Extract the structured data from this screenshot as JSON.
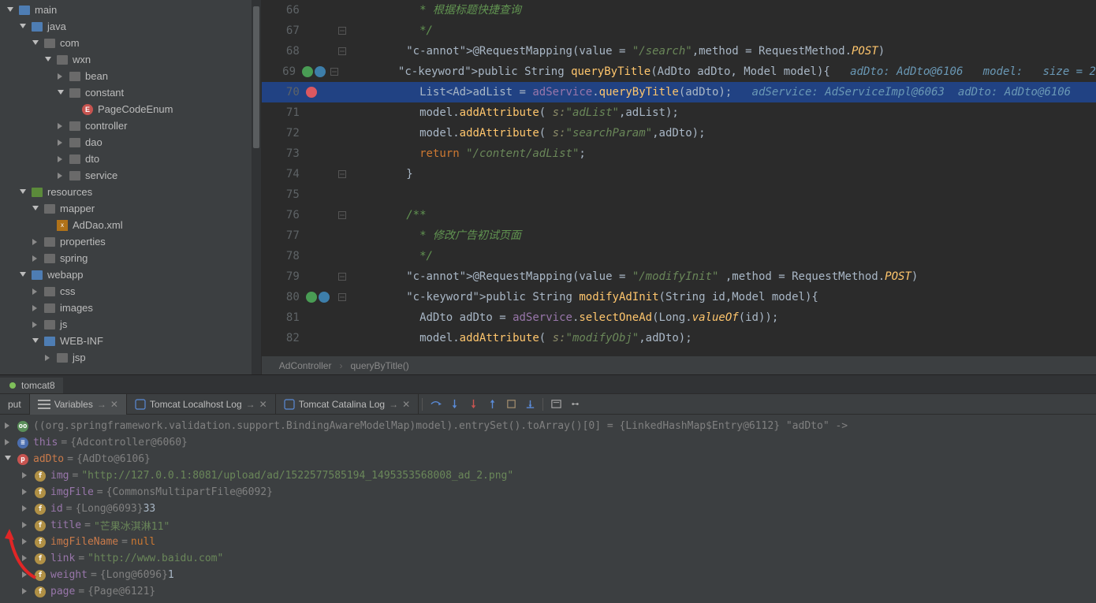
{
  "sidebar": {
    "main": "main",
    "java": "java",
    "com": "com",
    "wxn": "wxn",
    "bean": "bean",
    "constant": "constant",
    "pageCodeEnum": "PageCodeEnum",
    "controller": "controller",
    "dao": "dao",
    "dto": "dto",
    "service": "service",
    "resources": "resources",
    "mapper": "mapper",
    "adDaoXml": "AdDao.xml",
    "properties": "properties",
    "spring": "spring",
    "webapp": "webapp",
    "css": "css",
    "images": "images",
    "js": "js",
    "webinf": "WEB-INF",
    "jsp": "jsp"
  },
  "editor": {
    "lines": [
      {
        "n": 66,
        "indent": 20,
        "t": "comment",
        "text": "* 根据标题快捷查询"
      },
      {
        "n": 67,
        "indent": 20,
        "t": "comment",
        "text": "*/"
      },
      {
        "n": 68,
        "indent": 16,
        "t": "annot",
        "raw": "@RequestMapping(value = \"/search\",method = RequestMethod.POST)"
      },
      {
        "n": 69,
        "indent": 16,
        "mark": "okblue",
        "t": "mixed",
        "text": "public String queryByTitle(AdDto adDto, Model model){",
        "hint": "adDto: AdDto@6106   model:   size = 2"
      },
      {
        "n": 70,
        "indent": 20,
        "mark": "bp",
        "hl": true,
        "t": "mixed",
        "text": "List<Ad>adList = adService.queryByTitle(adDto);",
        "hint": "adService: AdServiceImpl@6063  adDto: AdDto@6106"
      },
      {
        "n": 71,
        "indent": 20,
        "t": "mixed",
        "text": "model.addAttribute( s:\"adList\",adList);"
      },
      {
        "n": 72,
        "indent": 20,
        "t": "mixed",
        "text": "model.addAttribute( s:\"searchParam\",adDto);"
      },
      {
        "n": 73,
        "indent": 20,
        "t": "return",
        "text": "return \"/content/adList\";"
      },
      {
        "n": 74,
        "indent": 16,
        "t": "plain",
        "text": "}"
      },
      {
        "n": 75,
        "indent": 0,
        "t": "plain",
        "text": ""
      },
      {
        "n": 76,
        "indent": 16,
        "t": "comment",
        "text": "/**"
      },
      {
        "n": 77,
        "indent": 20,
        "t": "comment",
        "text": "* 修改广告初试页面"
      },
      {
        "n": 78,
        "indent": 20,
        "t": "comment",
        "text": "*/"
      },
      {
        "n": 79,
        "indent": 16,
        "t": "annot",
        "raw": "@RequestMapping(value = \"/modifyInit\" ,method = RequestMethod.POST)"
      },
      {
        "n": 80,
        "indent": 16,
        "mark": "okblue",
        "t": "mixed",
        "text": "public String modifyAdInit(String id,Model model){"
      },
      {
        "n": 81,
        "indent": 20,
        "t": "mixed",
        "text": "AdDto adDto = adService.selectOneAd(Long.valueOf(id));"
      },
      {
        "n": 82,
        "indent": 20,
        "t": "mixed",
        "text": "model.addAttribute( s:\"modifyObj\",adDto);"
      }
    ],
    "breadcrumb": [
      "AdController",
      "queryByTitle()"
    ]
  },
  "debug": {
    "runTab": "tomcat8",
    "tabs": {
      "put": "put",
      "variables": "Variables",
      "tomcatLocal": "Tomcat Localhost Log",
      "tomcatCatalina": "Tomcat Catalina Log"
    },
    "watch": "((org.springframework.validation.support.BindingAwareModelMap)model).entrySet().toArray()[0] = {LinkedHashMap$Entry@6112} \"adDto\" ->",
    "thisRow": {
      "name": "this",
      "ref": "{Adcontroller@6060}"
    },
    "adDtoRow": {
      "name": "adDto",
      "ref": "{AdDto@6106}"
    },
    "fields": [
      {
        "badge": "f",
        "name": "img",
        "val": "\"http://127.0.0.1:8081/upload/ad/1522577585194_1495353568008_ad_2.png\""
      },
      {
        "badge": "f",
        "name": "imgFile",
        "ref": "{CommonsMultipartFile@6092}"
      },
      {
        "badge": "f",
        "name": "id",
        "ref": "{Long@6093}",
        "suffix": " 33"
      },
      {
        "badge": "f",
        "name": "title",
        "val": "\"芒果冰淇淋11\""
      },
      {
        "badge": "f",
        "name": "imgFileName",
        "null": true,
        "val": "null",
        "hot": true
      },
      {
        "badge": "f",
        "name": "link",
        "val": "\"http://www.baidu.com\""
      },
      {
        "badge": "f",
        "name": "weight",
        "ref": "{Long@6096}",
        "suffix": " 1"
      },
      {
        "badge": "f",
        "name": "page",
        "ref": "{Page@6121}"
      }
    ]
  }
}
